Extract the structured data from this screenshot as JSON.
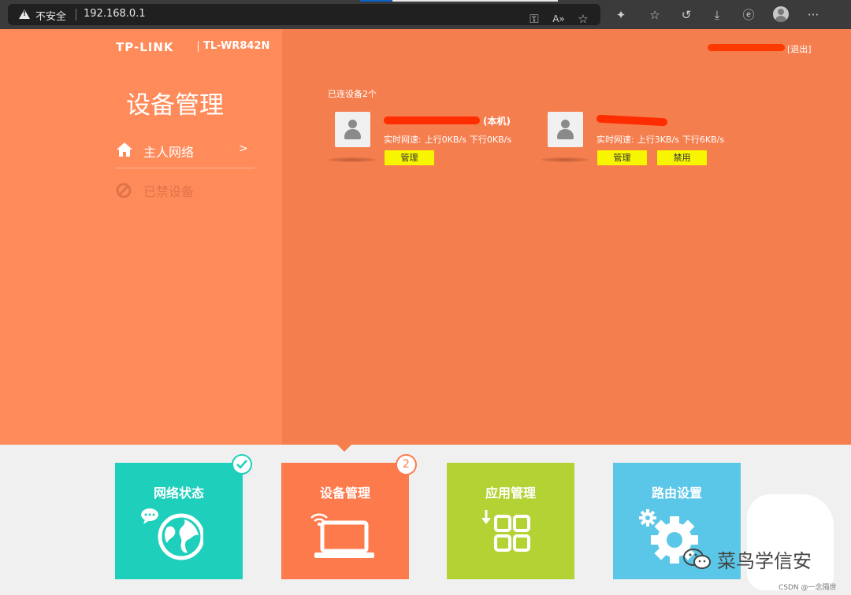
{
  "browser": {
    "insecure_label": "不安全",
    "url": "192.168.0.1",
    "icons": [
      "key-icon",
      "read-aloud-icon",
      "favorite-add-icon",
      "extensions-icon",
      "favorites-icon",
      "history-icon",
      "download-icon",
      "ie-mode-icon",
      "profile-icon",
      "more-icon"
    ]
  },
  "router": {
    "brand": "TP-LINK",
    "model": "TL-WR842N",
    "logout_label": "[退出]"
  },
  "sidebar": {
    "title": "设备管理",
    "items": [
      {
        "label": "主人网络",
        "arrow": ">",
        "icon": "home-icon"
      },
      {
        "label": "已禁设备",
        "icon": "ban-icon"
      }
    ]
  },
  "devices": {
    "count_label": "已连设备2个",
    "list": [
      {
        "local_tag": "(本机)",
        "speed_label": "实时网速:",
        "up": "上行0KB/s",
        "down": "下行0KB/s",
        "manage_label": "管理"
      },
      {
        "speed_label": "实时网速:",
        "up": "上行3KB/s",
        "down": "下行6KB/s",
        "manage_label": "管理",
        "block_label": "禁用"
      }
    ]
  },
  "tiles": [
    {
      "label": "网络状态",
      "color": "#1ecfbb",
      "icon": "globe-chat-icon"
    },
    {
      "label": "设备管理",
      "color": "#fd7a4c",
      "icon": "laptop-wifi-icon",
      "badge": "2"
    },
    {
      "label": "应用管理",
      "color": "#b3d335",
      "icon": "apps-grid-icon"
    },
    {
      "label": "路由设置",
      "color": "#5bc7e8",
      "icon": "gears-icon"
    }
  ],
  "watermark": {
    "text": "菜鸟学信安",
    "credit": "CSDN @一念隔世"
  }
}
